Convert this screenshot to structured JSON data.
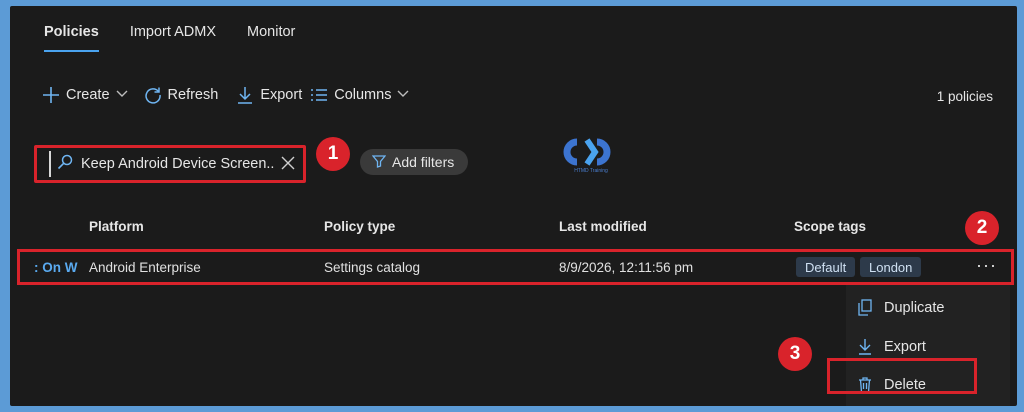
{
  "tabs": [
    {
      "label": "Policies",
      "active": true
    },
    {
      "label": "Import ADMX",
      "active": false
    },
    {
      "label": "Monitor",
      "active": false
    }
  ],
  "toolbar": {
    "create": "Create",
    "refresh": "Refresh",
    "export": "Export",
    "columns": "Columns",
    "count": "1 policies"
  },
  "search": {
    "value": "Keep Android Device Screen..."
  },
  "filters": {
    "label": "Add filters"
  },
  "logo": {
    "caption": "HTMD Training"
  },
  "table": {
    "headers": [
      "Platform",
      "Policy type",
      "Last modified",
      "Scope tags"
    ],
    "row": {
      "name_fragment": ": On W",
      "platform": "Android Enterprise",
      "policy_type": "Settings catalog",
      "last_modified": "8/9/2026, 12:11:56 pm",
      "tags": [
        "Default",
        "London"
      ],
      "more": "···"
    }
  },
  "menu": {
    "items": [
      {
        "label": "Duplicate",
        "icon": "copy-icon"
      },
      {
        "label": "Export",
        "icon": "download-icon"
      },
      {
        "label": "Delete",
        "icon": "trash-icon"
      }
    ]
  },
  "callouts": [
    "1",
    "2",
    "3"
  ],
  "colors": {
    "accent": "#4aa3ef",
    "highlight": "#d9232b",
    "background": "#1b1b1b",
    "frame": "#5c9bd6"
  }
}
